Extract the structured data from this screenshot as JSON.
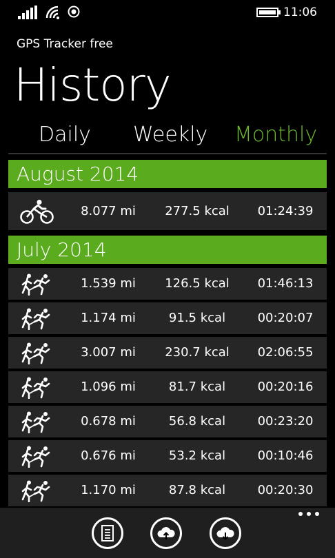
{
  "status": {
    "time": "11:06"
  },
  "app_title": "GPS Tracker free",
  "page_title": "History",
  "tabs": [
    {
      "label": "Daily",
      "active": false
    },
    {
      "label": "Weekly",
      "active": false
    },
    {
      "label": "Monthly",
      "active": true
    }
  ],
  "colors": {
    "accent": "#6cb82f",
    "group_header": "#5aab1e",
    "row_bg": "#262626"
  },
  "groups": [
    {
      "header": "August 2014",
      "rows": [
        {
          "activity": "cycling",
          "distance": "8.077 mi",
          "kcal": "277.5 kcal",
          "time": "01:24:39"
        }
      ]
    },
    {
      "header": "July 2014",
      "rows": [
        {
          "activity": "running",
          "distance": "1.539 mi",
          "kcal": "126.5 kcal",
          "time": "01:46:13"
        },
        {
          "activity": "running",
          "distance": "1.174 mi",
          "kcal": "91.5 kcal",
          "time": "00:20:07"
        },
        {
          "activity": "running",
          "distance": "3.007 mi",
          "kcal": "230.7 kcal",
          "time": "02:06:55"
        },
        {
          "activity": "running",
          "distance": "1.096 mi",
          "kcal": "81.7 kcal",
          "time": "00:20:16"
        },
        {
          "activity": "running",
          "distance": "0.678 mi",
          "kcal": "56.8 kcal",
          "time": "00:23:20"
        },
        {
          "activity": "running",
          "distance": "0.676 mi",
          "kcal": "53.2 kcal",
          "time": "00:10:46"
        },
        {
          "activity": "running",
          "distance": "1.170 mi",
          "kcal": "87.8 kcal",
          "time": "00:20:30"
        }
      ]
    }
  ],
  "appbar": {
    "buttons": [
      {
        "icon": "document-icon"
      },
      {
        "icon": "cloud-upload-icon"
      },
      {
        "icon": "cloud-download-icon"
      }
    ],
    "more_icon": "more-dots-icon"
  }
}
